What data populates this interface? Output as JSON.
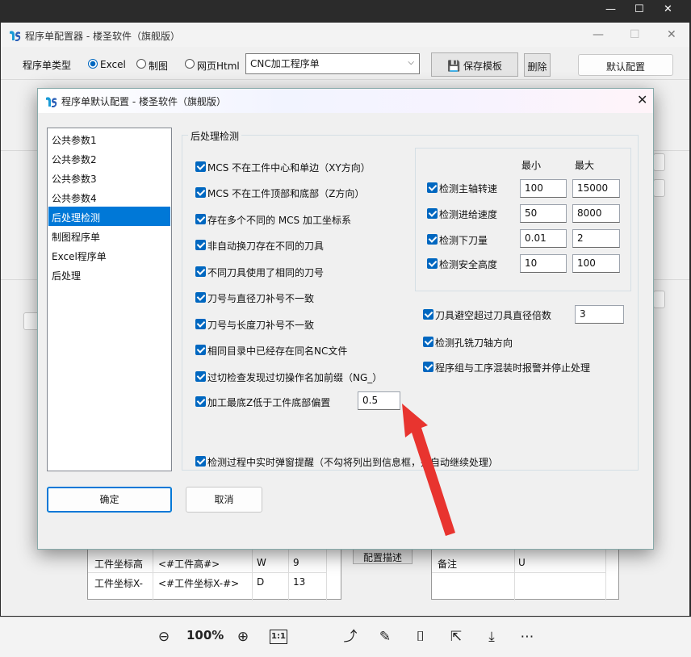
{
  "viewer": {
    "zoom": "100%",
    "bottom_icons": [
      "zoom-out-icon",
      "zoom-in-icon",
      "actual-size-icon",
      "rotate-icon",
      "edit-icon",
      "text-recognition-icon",
      "share-icon",
      "download-icon",
      "more-icon"
    ],
    "actual_size_label": "1:1"
  },
  "main_window": {
    "title": "程序单配置器 - 楼圣软件（旗舰版）",
    "type_label": "程序单类型",
    "radio_excel": "Excel",
    "radio_draw": "制图",
    "radio_html": "网页Html",
    "combo_value": "CNC加工程序单",
    "save_template": "保存模板",
    "delete": "删除",
    "default_config": "默认配置",
    "describe_config": "配置描述",
    "left_table": [
      {
        "name": "工件坐标高",
        "tag": "<#工件高#>",
        "col": "W",
        "num": "9"
      },
      {
        "name": "工件坐标X-",
        "tag": "<#工件坐标X-#>",
        "col": "D",
        "num": "13"
      }
    ],
    "right_table": [
      {
        "name": "备注",
        "col": "U"
      }
    ]
  },
  "dialog": {
    "title": "程序单默认配置 - 楼圣软件（旗舰版）",
    "nav_items": [
      "公共参数1",
      "公共参数2",
      "公共参数3",
      "公共参数4",
      "后处理检测",
      "制图程序单",
      "Excel程序单",
      "后处理"
    ],
    "selected_index": 4,
    "group_title": "后处理检测",
    "checks": [
      "MCS 不在工件中心和单边（XY方向）",
      "MCS 不在工件顶部和底部（Z方向）",
      "存在多个不同的 MCS 加工坐标系",
      "非自动换刀存在不同的刀具",
      "不同刀具使用了相同的刀号",
      "刀号与直径刀补号不一致",
      "刀号与长度刀补号不一致",
      "相同目录中已经存在同名NC文件",
      "过切检查发现过切操作名加前缀（NG_）",
      "加工最底Z低于工件底部偏置"
    ],
    "bottom_offset_value": "0.5",
    "popup_check": "检测过程中实时弹窗提醒（不勾将列出到信息框，并自动继续处理）",
    "range_header_min": "最小",
    "range_header_max": "最大",
    "ranges": [
      {
        "label": "检测主轴转速",
        "min": "100",
        "max": "15000"
      },
      {
        "label": "检测进给速度",
        "min": "50",
        "max": "8000"
      },
      {
        "label": "检测下刀量",
        "min": "0.01",
        "max": "2"
      },
      {
        "label": "检测安全高度",
        "min": "10",
        "max": "100"
      }
    ],
    "avoid_label": "刀具避空超过刀具直径倍数",
    "avoid_value": "3",
    "hole_axis": "检测孔铣刀轴方向",
    "mix_alarm": "程序组与工序混装时报警并停止处理",
    "ok": "确定",
    "cancel": "取消"
  },
  "colors": {
    "accent": "#0078d7",
    "check": "#0067c0",
    "arrow": "#e8342f"
  }
}
